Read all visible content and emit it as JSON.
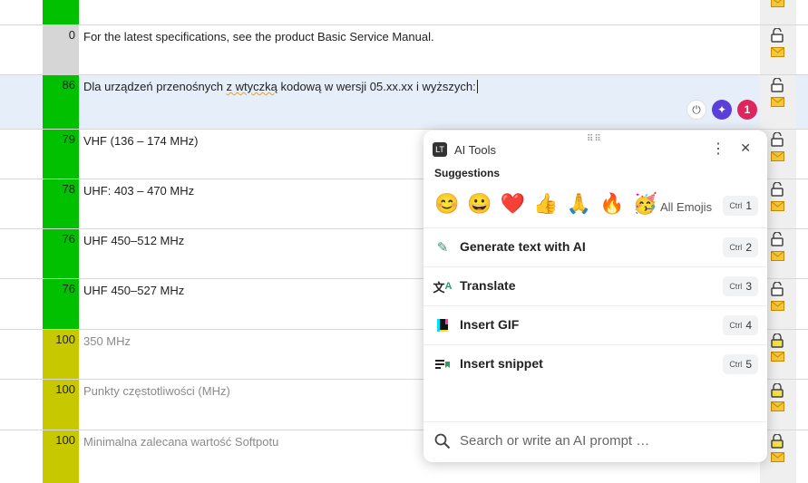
{
  "rows": [
    {
      "match": "",
      "text": "",
      "color": "green"
    },
    {
      "match": "0",
      "text": "For the latest specifications, see the product Basic Service Manual.",
      "color": "gray"
    },
    {
      "match": "86",
      "text_before": "Dla urządzeń przenośnych ",
      "text_flag": "z wtyczką",
      "text_after": " kodową w wersji 05.xx.xx i wyższych:",
      "color": "green"
    },
    {
      "match": "79",
      "text": "VHF (136 – 174 MHz)",
      "color": "green"
    },
    {
      "match": "78",
      "text": "UHF: 403 – 470 MHz",
      "color": "green"
    },
    {
      "match": "76",
      "text": "UHF 450–512 MHz",
      "color": "green"
    },
    {
      "match": "76",
      "text": "UHF 450–527 MHz",
      "color": "green"
    },
    {
      "match": "100",
      "text": "350 MHz",
      "color": "olive"
    },
    {
      "match": "100",
      "text": "Punkty częstotliwości (MHz)",
      "color": "olive"
    },
    {
      "match": "100",
      "text": "Minimalna zalecana wartość Softpotu",
      "color": "olive"
    }
  ],
  "bubble": {
    "count": "1"
  },
  "ai_tools": {
    "title": "AI Tools",
    "suggestions_label": "Suggestions",
    "emojis": [
      "😊",
      "😀",
      "❤️",
      "👍",
      "🙏",
      "🔥",
      "🥳"
    ],
    "all_emojis": "All Emojis",
    "all_emojis_key": "1",
    "ctrl": "Ctrl",
    "items": [
      {
        "label": "Generate text with AI",
        "key": "2",
        "icon": "ai-pen-icon"
      },
      {
        "label": "Translate",
        "key": "3",
        "icon": "translate-icon"
      },
      {
        "label": "Insert GIF",
        "key": "4",
        "icon": "gif-icon"
      },
      {
        "label": "Insert snippet",
        "key": "5",
        "icon": "snippet-icon"
      }
    ],
    "search_placeholder": "Search or write an AI prompt …"
  },
  "colors": {
    "green": "#00c000",
    "gray": "#d6d6d6",
    "olive": "#c8c800",
    "accent": "#5b3fd9"
  }
}
